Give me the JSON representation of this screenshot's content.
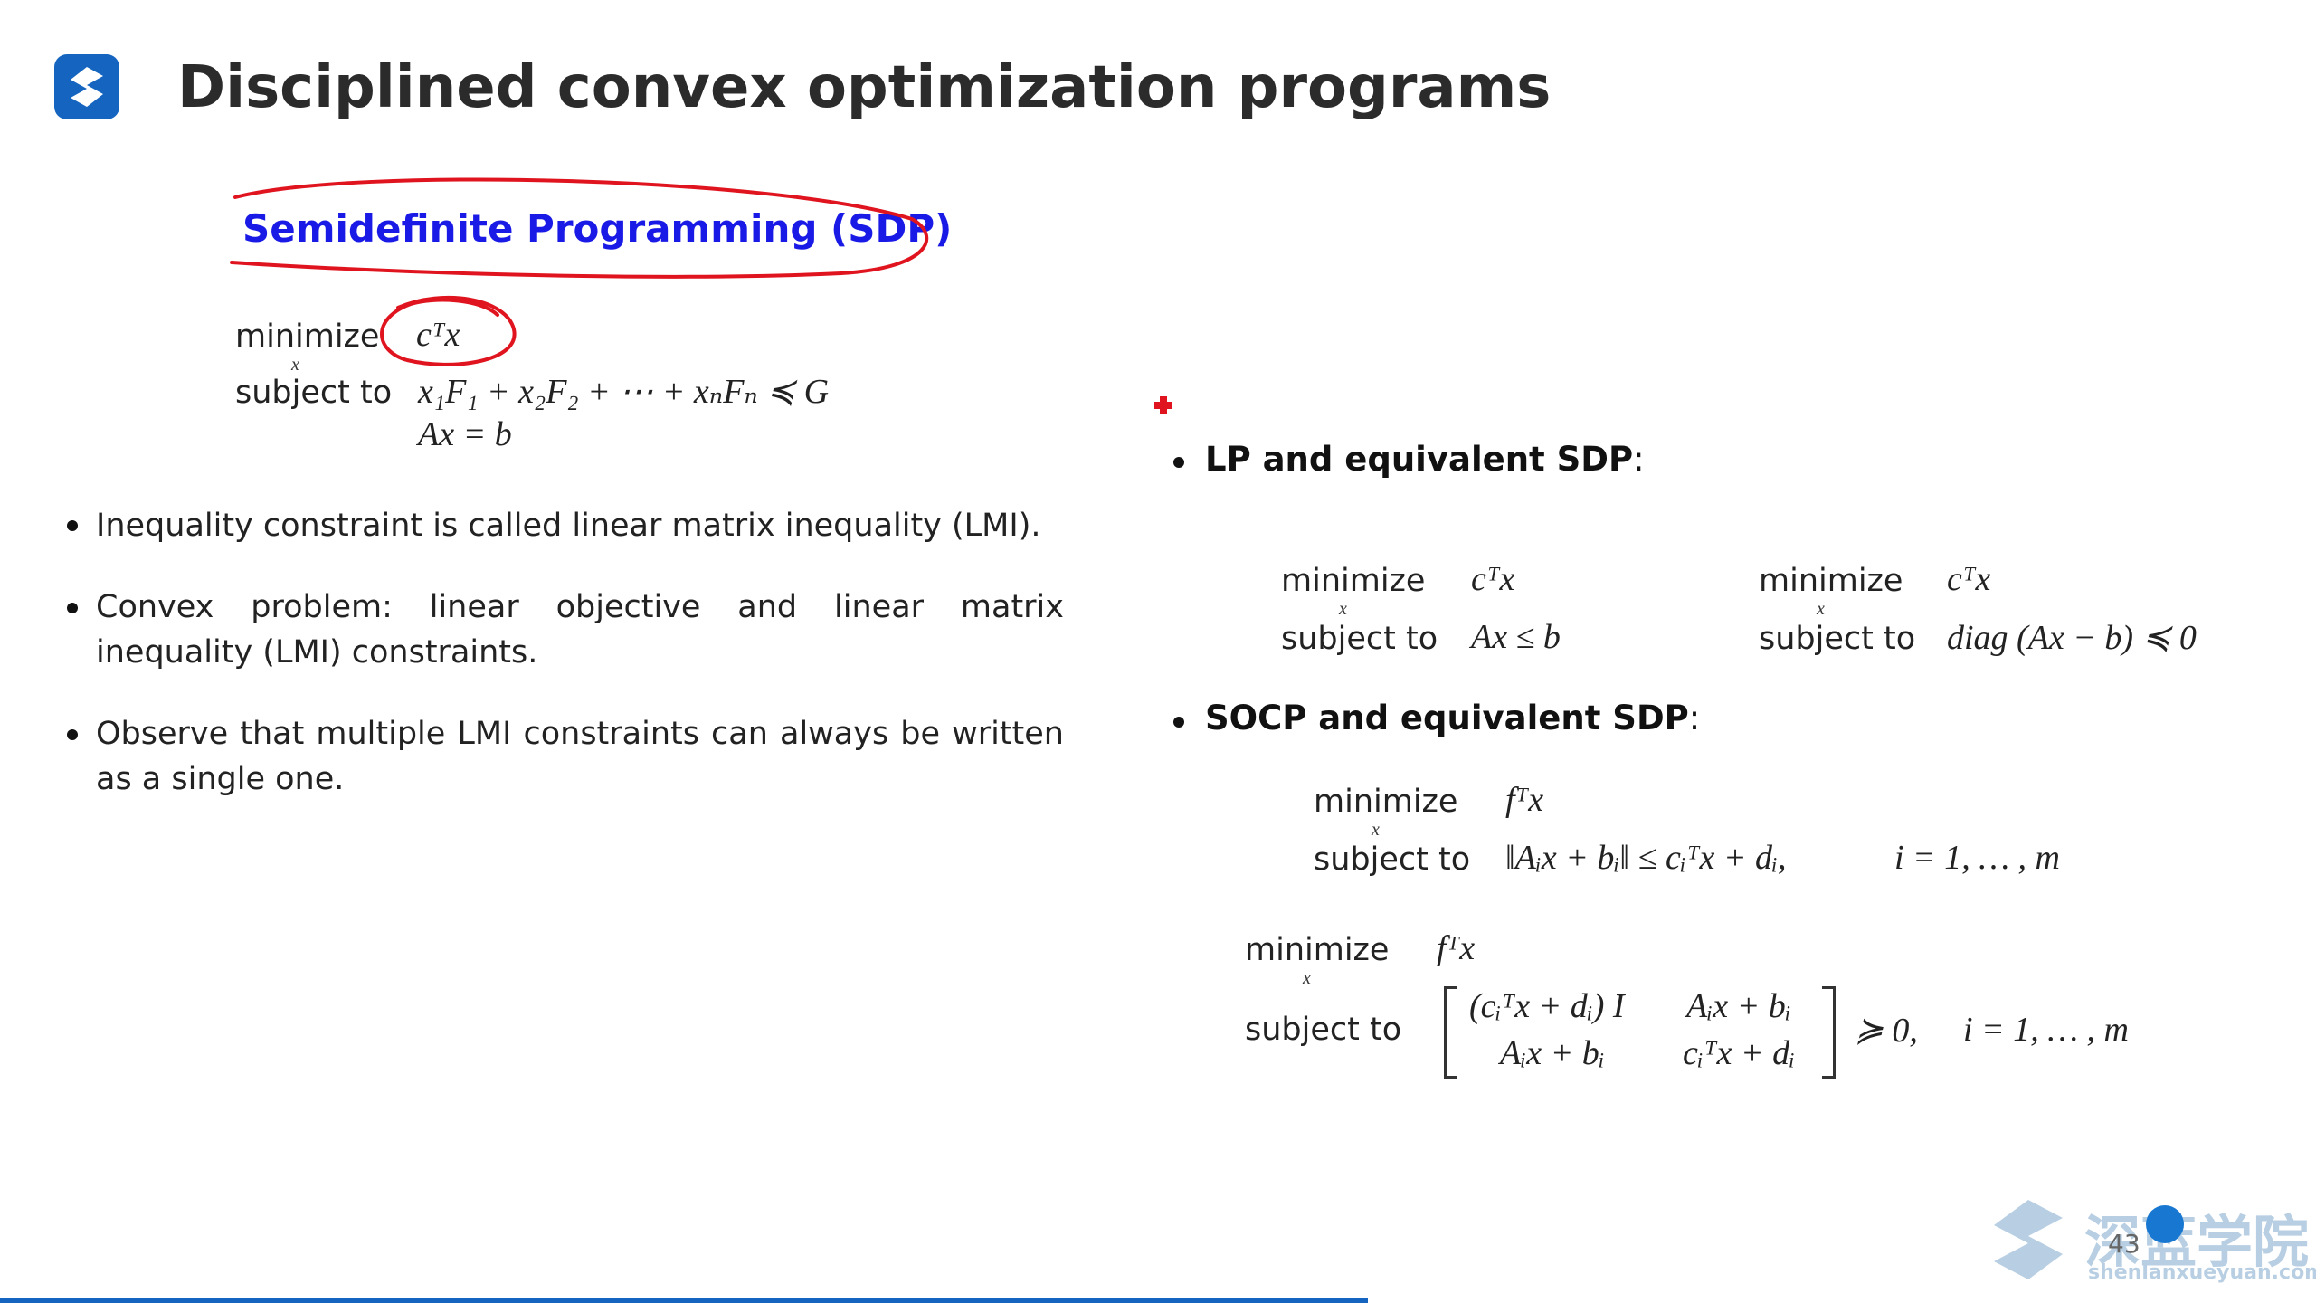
{
  "slide": {
    "title": "Disciplined convex optimization programs",
    "page_number": "43"
  },
  "sdp": {
    "heading": "Semidefinite Programming (SDP)",
    "minimize_label": "minimize",
    "subject_to_label": "subject to",
    "var": "x",
    "objective": "cᵀx",
    "constraint1": "x₁F₁ + x₂F₂ + ⋯ + xₙFₙ ≼ G",
    "constraint2": "Ax = b"
  },
  "bullets": [
    "Inequality constraint is called linear matrix inequality (LMI).",
    "Convex problem: linear objective and linear matrix inequality (LMI) constraints.",
    "Observe that multiple LMI constraints can always be written as a single one."
  ],
  "lp": {
    "heading": "LP and equivalent SDP",
    "minimize_label": "minimize",
    "subject_to_label": "subject to",
    "var": "x",
    "left_objective": "cᵀx",
    "left_constraint": "Ax ≤ b",
    "right_objective": "cᵀx",
    "right_constraint": "diag (Ax − b) ≼ 0"
  },
  "socp": {
    "heading": "SOCP and equivalent SDP",
    "minimize_label": "minimize",
    "subject_to_label": "subject to",
    "var": "x",
    "objective": "fᵀx",
    "constraint": "‖Aᵢx + bᵢ‖ ≤ cᵢᵀx + dᵢ,",
    "index_range": "i = 1, … , m",
    "sdp_objective": "fᵀx",
    "matrix": {
      "m11": "(cᵢᵀx + dᵢ) I",
      "m12": "Aᵢx + bᵢ",
      "m21": "Aᵢx + bᵢ",
      "m22": "cᵢᵀx + dᵢ"
    },
    "sdp_relation": "≽ 0,",
    "sdp_index_range": "i = 1, … , m"
  },
  "watermark": {
    "name": "深蓝学院",
    "url": "shenlanxueyuan.com"
  },
  "colors": {
    "accent": "#1565c0",
    "heading_blue": "#1a1ae6",
    "annotation_red": "#e0141e"
  },
  "icons": [
    "app-logo-icon",
    "brand-logo-icon"
  ]
}
